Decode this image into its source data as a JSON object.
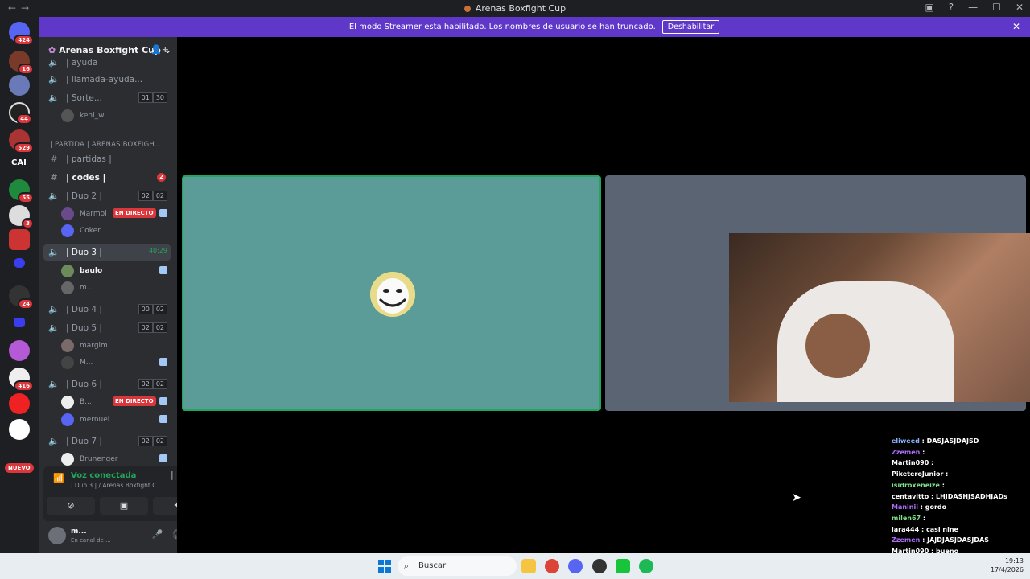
{
  "window": {
    "title": "Arenas Boxfight Cup"
  },
  "banner": {
    "text": "El modo Streamer está habilitado. Los nombres de usuario se han truncado.",
    "button": "Deshabilitar"
  },
  "rail": {
    "badges": [
      "424",
      "16",
      "44",
      "529",
      "55",
      "3",
      "24",
      "416"
    ],
    "cai_label": "CAI",
    "new_label": "NUEVO"
  },
  "server": {
    "name": "Arenas Boxfight Cup"
  },
  "channels": {
    "c0": "| ayuda",
    "c1": "| llamada-ayuda...",
    "c2": "| Sorte...",
    "c2_a": "01",
    "c2_b": "30",
    "c2_user": "keni_w",
    "category": "| PARTIDA | ARENAS BOXFIGH...",
    "partidas": "| partidas |",
    "codes": "| codes |",
    "codes_badge": "2",
    "duo2": "| Duo 2 |",
    "duo2_a": "02",
    "duo2_b": "02",
    "duo2_u1": "Marmol",
    "duo2_u2": "Coker",
    "duo3": "| Duo 3 |",
    "duo3_time": "40:29",
    "duo3_u1": "baulo",
    "duo3_u2": "m...",
    "duo4": "| Duo 4 |",
    "duo4_a": "00",
    "duo4_b": "02",
    "duo5": "| Duo 5 |",
    "duo5_a": "02",
    "duo5_b": "02",
    "duo5_u1": "margim",
    "duo5_u2": "M...",
    "duo6": "| Duo 6 |",
    "duo6_a": "02",
    "duo6_b": "02",
    "duo6_u1": "B...",
    "duo6_u2": "mernuel",
    "duo7": "| Duo 7 |",
    "duo7_a": "02",
    "duo7_b": "02",
    "duo7_u1": "Brunenger",
    "live": "EN DIRECTO"
  },
  "voice": {
    "status": "Voz conectada",
    "sub": "| Duo 3 |  / Arenas Boxfight C..."
  },
  "userbar": {
    "name": "m...",
    "status": "En canal de ..."
  },
  "chat": [
    {
      "user": "eliweed",
      "msg": "DASJASJDAJSD",
      "color": "#8ab4ff"
    },
    {
      "user": "Zzemen",
      "msg": "",
      "color": "#b06cff"
    },
    {
      "user": "Martin090",
      "msg": "",
      "color": "#ffffff"
    },
    {
      "user": "PiketeroJunior",
      "msg": "",
      "color": "#ffffff"
    },
    {
      "user": "isidroxeneize",
      "msg": "",
      "color": "#7fe08a"
    },
    {
      "user": "centavitto",
      "msg": "LHJDASHJSADHJADs",
      "color": "#ffffff"
    },
    {
      "user": "Maninii",
      "msg": "gordo",
      "color": "#b06cff"
    },
    {
      "user": "milen67",
      "msg": "",
      "color": "#7fe08a"
    },
    {
      "user": "lara444",
      "msg": "casi nine",
      "color": "#ffffff"
    },
    {
      "user": "Zzemen",
      "msg": "JAJDJASJDASJDAS",
      "color": "#b06cff"
    },
    {
      "user": "Martin090",
      "msg": "bueno",
      "color": "#ffffff"
    }
  ],
  "taskbar": {
    "search": "Buscar",
    "time": "19:13",
    "date": "17/4/2026"
  }
}
